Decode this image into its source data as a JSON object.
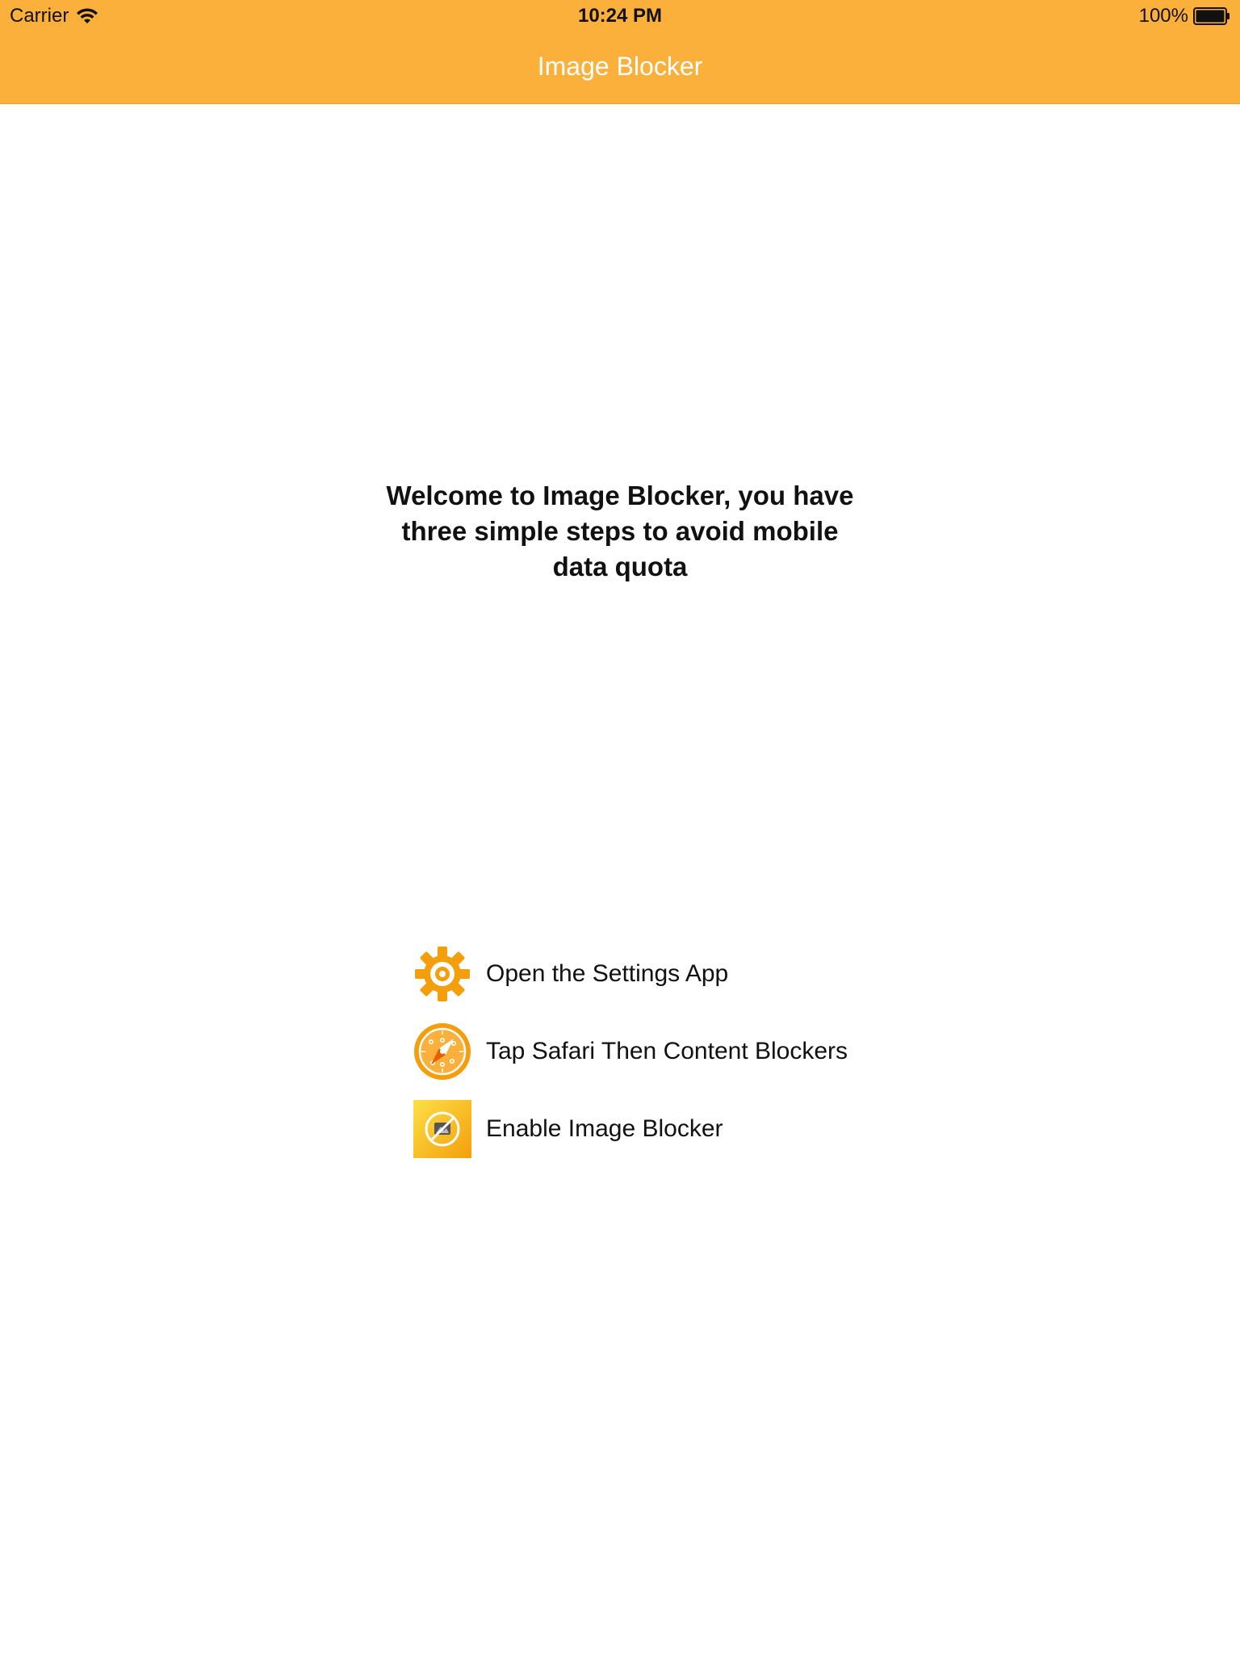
{
  "status_bar": {
    "carrier": "Carrier",
    "time": "10:24 PM",
    "battery": "100%"
  },
  "nav": {
    "title": "Image Blocker"
  },
  "welcome_text": "Welcome to Image Blocker, you have three simple steps to avoid mobile data quota",
  "steps": [
    {
      "icon": "gear-icon",
      "label": "Open the Settings App"
    },
    {
      "icon": "compass-icon",
      "label": "Tap Safari Then Content Blockers"
    },
    {
      "icon": "image-blocker-app-icon",
      "label": "Enable Image Blocker"
    }
  ],
  "colors": {
    "nav_bar": "#FBB03B",
    "icon_orange": "#F59E0B"
  }
}
